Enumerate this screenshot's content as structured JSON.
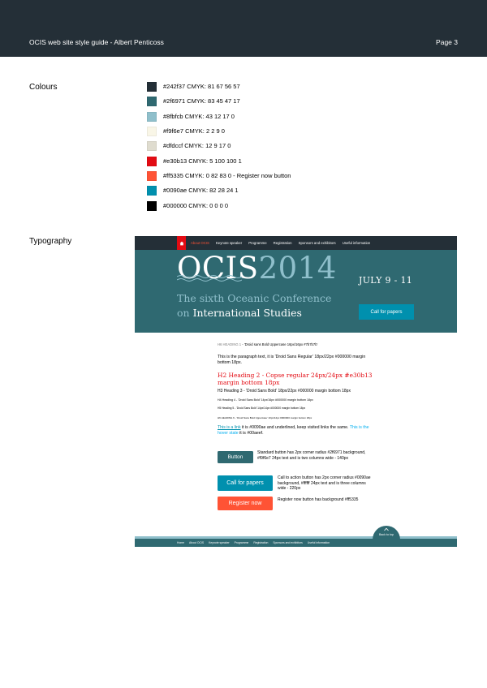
{
  "header": {
    "title": "OCIS web site style guide - Albert Penticoss",
    "page": "Page 3"
  },
  "colours": {
    "label": "Colours",
    "items": [
      {
        "hex": "#242f37",
        "text": "#242f37 CMYK: 81 67 56 57"
      },
      {
        "hex": "#2f6971",
        "text": "#2f6971 CMYK: 83 45 47 17"
      },
      {
        "hex": "#8fbfcb",
        "text": "#8fbfcb CMYK: 43 12 17 0"
      },
      {
        "hex": "#f9f6e7",
        "text": "#f9f6e7 CMYK: 2 2 9 0"
      },
      {
        "hex": "#dfdccf",
        "text": "#dfdccf CMYK: 12 9 17 0"
      },
      {
        "hex": "#e30b13",
        "text": "#e30b13 CMYK: 5 100 100 1"
      },
      {
        "hex": "#ff5335",
        "text": "#ff5335 CMYK: 0 82 83 0 - Register now button"
      },
      {
        "hex": "#0090ae",
        "text": "#0090ae CMYK: 82 28 24 1"
      },
      {
        "hex": "#000000",
        "text": "#000000 CMYK: 0 0 0 0"
      }
    ]
  },
  "typography": {
    "label": "Typography"
  },
  "mockup": {
    "nav": [
      "About OCIS",
      "Keynote speaker",
      "Programme",
      "Registration",
      "Sponsors and exhibitors",
      "Useful information"
    ],
    "logo_ocis": "OCIS",
    "logo_year": "2014",
    "dates": "JULY 9 - 11",
    "tagline_1": "The sixth Oceanic Conference",
    "tagline_2_pre": "on ",
    "tagline_2_strong": "International Studies",
    "hero_button": "Call for papers",
    "h6_title": "H6 HEADING 1",
    "h6_desc": " - 'Droid sans Bold Uppercase 16px/16px #7b7b7b'",
    "paragraph": "This is the paragraph text, it is 'Droid Sans Regular' 18px/22px #000000 margin bottom 18px.",
    "h2": "H2 Heading 2 - Copse regular 24px/24px #e30b13 margin bottom 18px",
    "h3": "H3 Heading 3 - 'Droid Sans Bold' 18px/22px #000000 margin bottom 18px",
    "h4": "H4 Heading 4 - 'Droid Sans Bold' 14px/16px #000000 margin bottom 18px",
    "h5": "H5 Heading 5 - 'Droid Sans Bold' 14px/14px #000000 margin bottom 18px",
    "h6": "H6 HEADING 6 - 'Droid Sans Bold Uppercase' 10px/12px #000000 margin bottom 18px",
    "link_a": "This is a link",
    "link_mid": " it is #0090ae and underlined, keep visited links the same. ",
    "link_b": "This is the hover state",
    "link_end": " it is #00aeef.",
    "button_std": "Button",
    "button_std_desc": "Standard button has 2px corner radius #2f6971 background, #f9f6e7 24px text and is two columns wide - 140px",
    "button_cta": "Call for papers",
    "button_cta_desc": "Call to action button has 2px corner radius #0090ae background, #ffffff 24px text and is three columns wide - 220px",
    "button_reg": "Register now",
    "button_reg_desc": "Register now button has background #ff5335",
    "back_to_top": "Back to top",
    "footer": [
      "Home",
      "About OCIS",
      "Keynote speaker",
      "Programme",
      "Registration",
      "Sponsors and exhibitors",
      "Useful information"
    ]
  }
}
